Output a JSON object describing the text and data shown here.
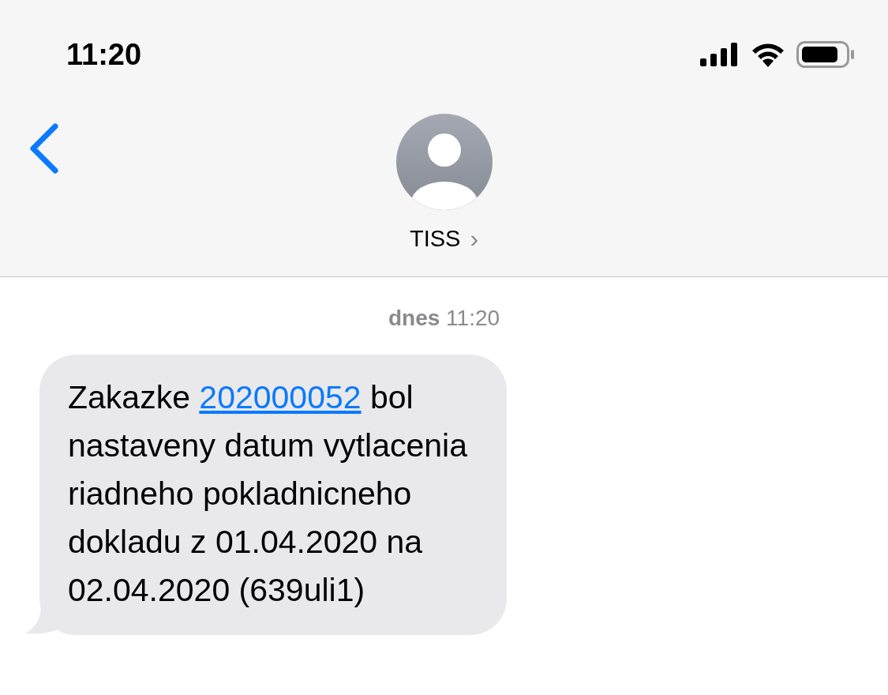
{
  "status_bar": {
    "time": "11:20"
  },
  "header": {
    "contact_name": "TISS",
    "chevron": "›"
  },
  "timestamp": "**dnes** 11:20",
  "message": {
    "parts": [
      {
        "kind": "text",
        "text": "Zakazke "
      },
      {
        "kind": "link",
        "text": "202000052"
      },
      {
        "kind": "text",
        "text": " bol\nnastaveny datum vytlacenia\nriadneho pokladnicneho\ndokladu z 01.04.2020 na\n02.04.2020 (639uli1)"
      }
    ]
  }
}
